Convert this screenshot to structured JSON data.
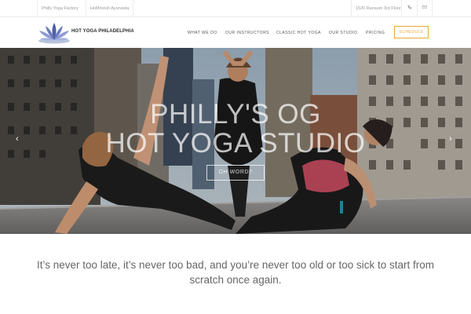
{
  "topbar": {
    "link1": "Philly Yoga Factory",
    "link2": "HoMmesh Ayurveda",
    "address": "1520 Ransom 3rd Floor",
    "icons": [
      "phone-icon",
      "email-icon"
    ]
  },
  "header": {
    "brand_name": "HOT YOGA PHILADELPHIA",
    "logo_icon": "lotus-logo",
    "nav": [
      "WHAT WE DO",
      "OUR INSTRUCTORS",
      "CLASSIC HOT YOGA",
      "OUR STUDIO",
      "PRICING"
    ],
    "schedule_label": "SCHEDULE",
    "accent_color": "#e6a934"
  },
  "hero": {
    "title_line1": "PHILLY'S OG",
    "title_line2": "HOT YOGA STUDIO",
    "button_label": "OH WORD?",
    "prev_arrow": "‹",
    "next_arrow": "›"
  },
  "quote": {
    "text": "It’s never too late, it’s never too bad, and you’re never too old or too sick to start from scratch once again."
  }
}
